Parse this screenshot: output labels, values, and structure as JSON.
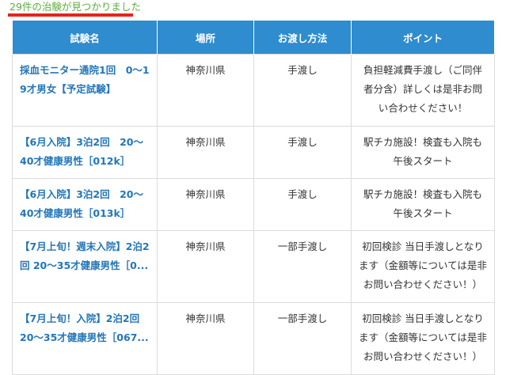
{
  "result_count": "29件の治験が見つかりました",
  "table": {
    "headers": [
      "試験名",
      "場所",
      "お渡し方法",
      "ポイント"
    ],
    "rows": [
      {
        "name": "採血モニター通院1回　0～19才男女【予定試験】",
        "place": "神奈川県",
        "method": "手渡し",
        "point": "負担軽減費手渡し（ご同伴者分含）詳しくは是非お問い合わせください！"
      },
      {
        "name": "【6月入院】3泊2回　20～40才健康男性［012k］",
        "place": "神奈川県",
        "method": "手渡し",
        "point": "駅チカ施設！検査も入院も午後スタート"
      },
      {
        "name": "【6月入院】3泊2回　20～40才健康男性［013k］",
        "place": "神奈川県",
        "method": "手渡し",
        "point": "駅チカ施設！検査も入院も午後スタート"
      },
      {
        "name": "【7月上旬！週末入院】2泊2回 20～35才健康男性［0...",
        "place": "神奈川県",
        "method": "一部手渡し",
        "point": "初回検診 当日手渡しとなります（金額等については是非お問い合わせください！）"
      },
      {
        "name": "【7月上旬！入院】2泊2回 20～35才健康男性［067...",
        "place": "神奈川県",
        "method": "一部手渡し",
        "point": "初回検診 当日手渡しとなります（金額等については是非お問い合わせください！）"
      }
    ]
  },
  "colors": {
    "header_bg": "#2e8ccf",
    "link": "#2376b8",
    "count_text": "#5cae3c",
    "underline": "#e8231b"
  }
}
